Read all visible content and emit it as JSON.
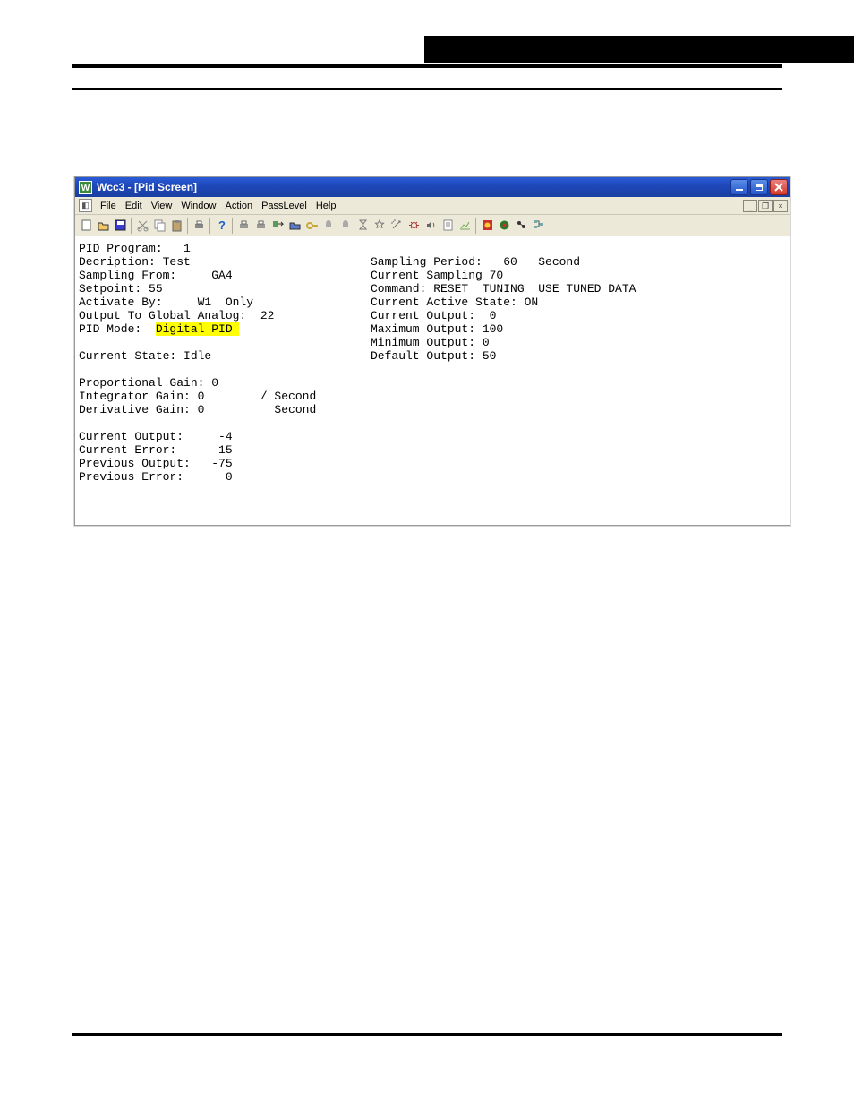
{
  "page": {
    "title_outer": "Wcc3 - [Pid Screen]",
    "app_badge": "W"
  },
  "menus": {
    "file": "File",
    "edit": "Edit",
    "view": "View",
    "window": "Window",
    "action": "Action",
    "passlevel": "PassLevel",
    "help": "Help"
  },
  "left": {
    "l1": "PID Program:   1",
    "l2": "Decription: Test",
    "l3": "Sampling From:     GA4",
    "l4": "Setpoint: 55",
    "l5": "Activate By:     W1  Only",
    "l6": "Output To Global Analog:  22",
    "l7a": "PID Mode:  ",
    "l7b": "Digital PID ",
    "l8": "Current State: Idle",
    "l9": "Proportional Gain: 0",
    "l10": "Integrator Gain: 0        / Second",
    "l11": "Derivative Gain: 0          Second",
    "l12": "Current Output:     -4",
    "l13": "Current Error:     -15",
    "l14": "Previous Output:   -75",
    "l15": "Previous Error:      0"
  },
  "right": {
    "r1": "Sampling Period:   60   Second",
    "r2": "Current Sampling 70",
    "r3": "Command: RESET  TUNING  USE TUNED DATA",
    "r4": "Current Active State: ON",
    "r5": "Current Output:  0",
    "r6": "Maximum Output: 100",
    "r7": "Minimum Output: 0",
    "r8": "Default Output: 50"
  }
}
